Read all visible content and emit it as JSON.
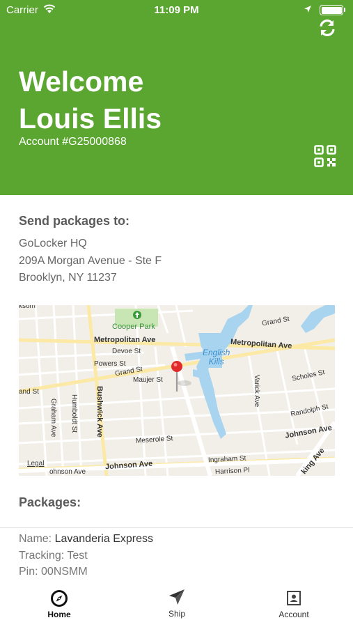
{
  "status_bar": {
    "carrier": "Carrier",
    "time": "11:09 PM"
  },
  "header": {
    "welcome": "Welcome",
    "user_name": "Louis Ellis",
    "account": "Account #G25000868",
    "refresh_icon": "refresh-icon",
    "qr_icon": "qr-code-icon"
  },
  "address": {
    "title": "Send packages to:",
    "lines": [
      "GoLocker HQ",
      "209A Morgan Avenue - Ste F",
      "Brooklyn, NY 11237"
    ]
  },
  "map": {
    "legal": "Legal",
    "labels": {
      "cooper_park": "Cooper Park",
      "grand_st_top": "Grand St",
      "metropolitan_left": "Metropolitan Ave",
      "metropolitan_right": "Metropolitan Ave",
      "devoe": "Devoe St",
      "powers": "Powers St",
      "grand_st_mid": "Grand St",
      "maujer": "Maujer St",
      "and_st": "and St",
      "english_kills": "English Kills",
      "scholes": "Scholes St",
      "varick": "Varick Ave",
      "randolph": "Randolph St",
      "johnson_right": "Johnson Ave",
      "graham": "Graham Ave",
      "humboldt": "Humboldt St",
      "bushwick": "Bushwick Ave",
      "meserole": "Meserole St",
      "johnson_bottom": "Johnson Ave",
      "ingraham": "Ingraham St",
      "harrison": "Harrison Pl",
      "ohnson_left": "ohnson Ave",
      "king_ave": "king Ave",
      "top_left": "ksom"
    }
  },
  "packages": {
    "title": "Packages:",
    "items": [
      {
        "name_label": "Name: ",
        "name": "Lavanderia Express",
        "tracking_label": "Tracking: ",
        "tracking": "Test",
        "pin_label": "Pin: ",
        "pin": "00NSMM"
      }
    ]
  },
  "tabbar": {
    "tabs": [
      {
        "label": "Home",
        "icon": "compass-icon",
        "active": true
      },
      {
        "label": "Ship",
        "icon": "paper-plane-icon",
        "active": false
      },
      {
        "label": "Account",
        "icon": "contact-card-icon",
        "active": false
      }
    ]
  },
  "colors": {
    "brand_green": "#5aa631",
    "water": "#a8d4f0",
    "park": "#c8e6b4"
  }
}
